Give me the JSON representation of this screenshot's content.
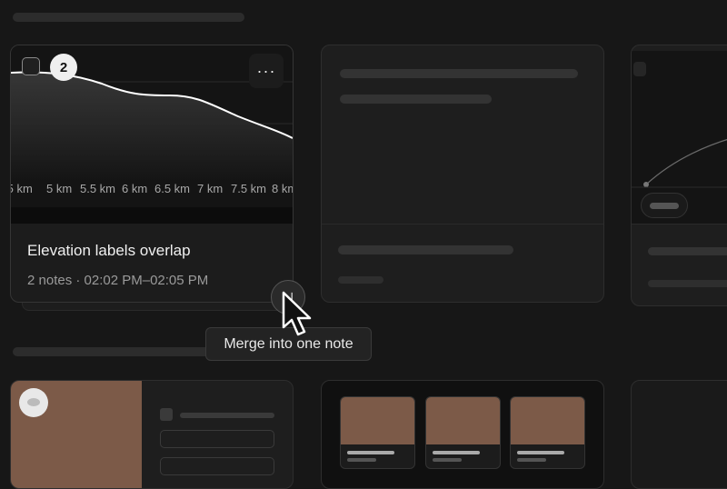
{
  "main_card": {
    "selected_count": "2",
    "more_label": "···",
    "title": "Elevation labels overlap",
    "subtitle": "2 notes · 02:02 PM–02:05 PM"
  },
  "chart_data": {
    "type": "area",
    "x_tick_labels": [
      ".5 km",
      "5 km",
      "5.5 km",
      "6 km",
      "6.5 km",
      "7 km",
      "7.5 km",
      "8 km"
    ],
    "line_color": "#ffffff"
  },
  "merge_button": {
    "icon_label": "⋃"
  },
  "tooltip": {
    "text": "Merge into one note"
  },
  "colors": {
    "background": "#171717",
    "card": "#1e1e1e",
    "thumbnail": "#7c5a48"
  }
}
